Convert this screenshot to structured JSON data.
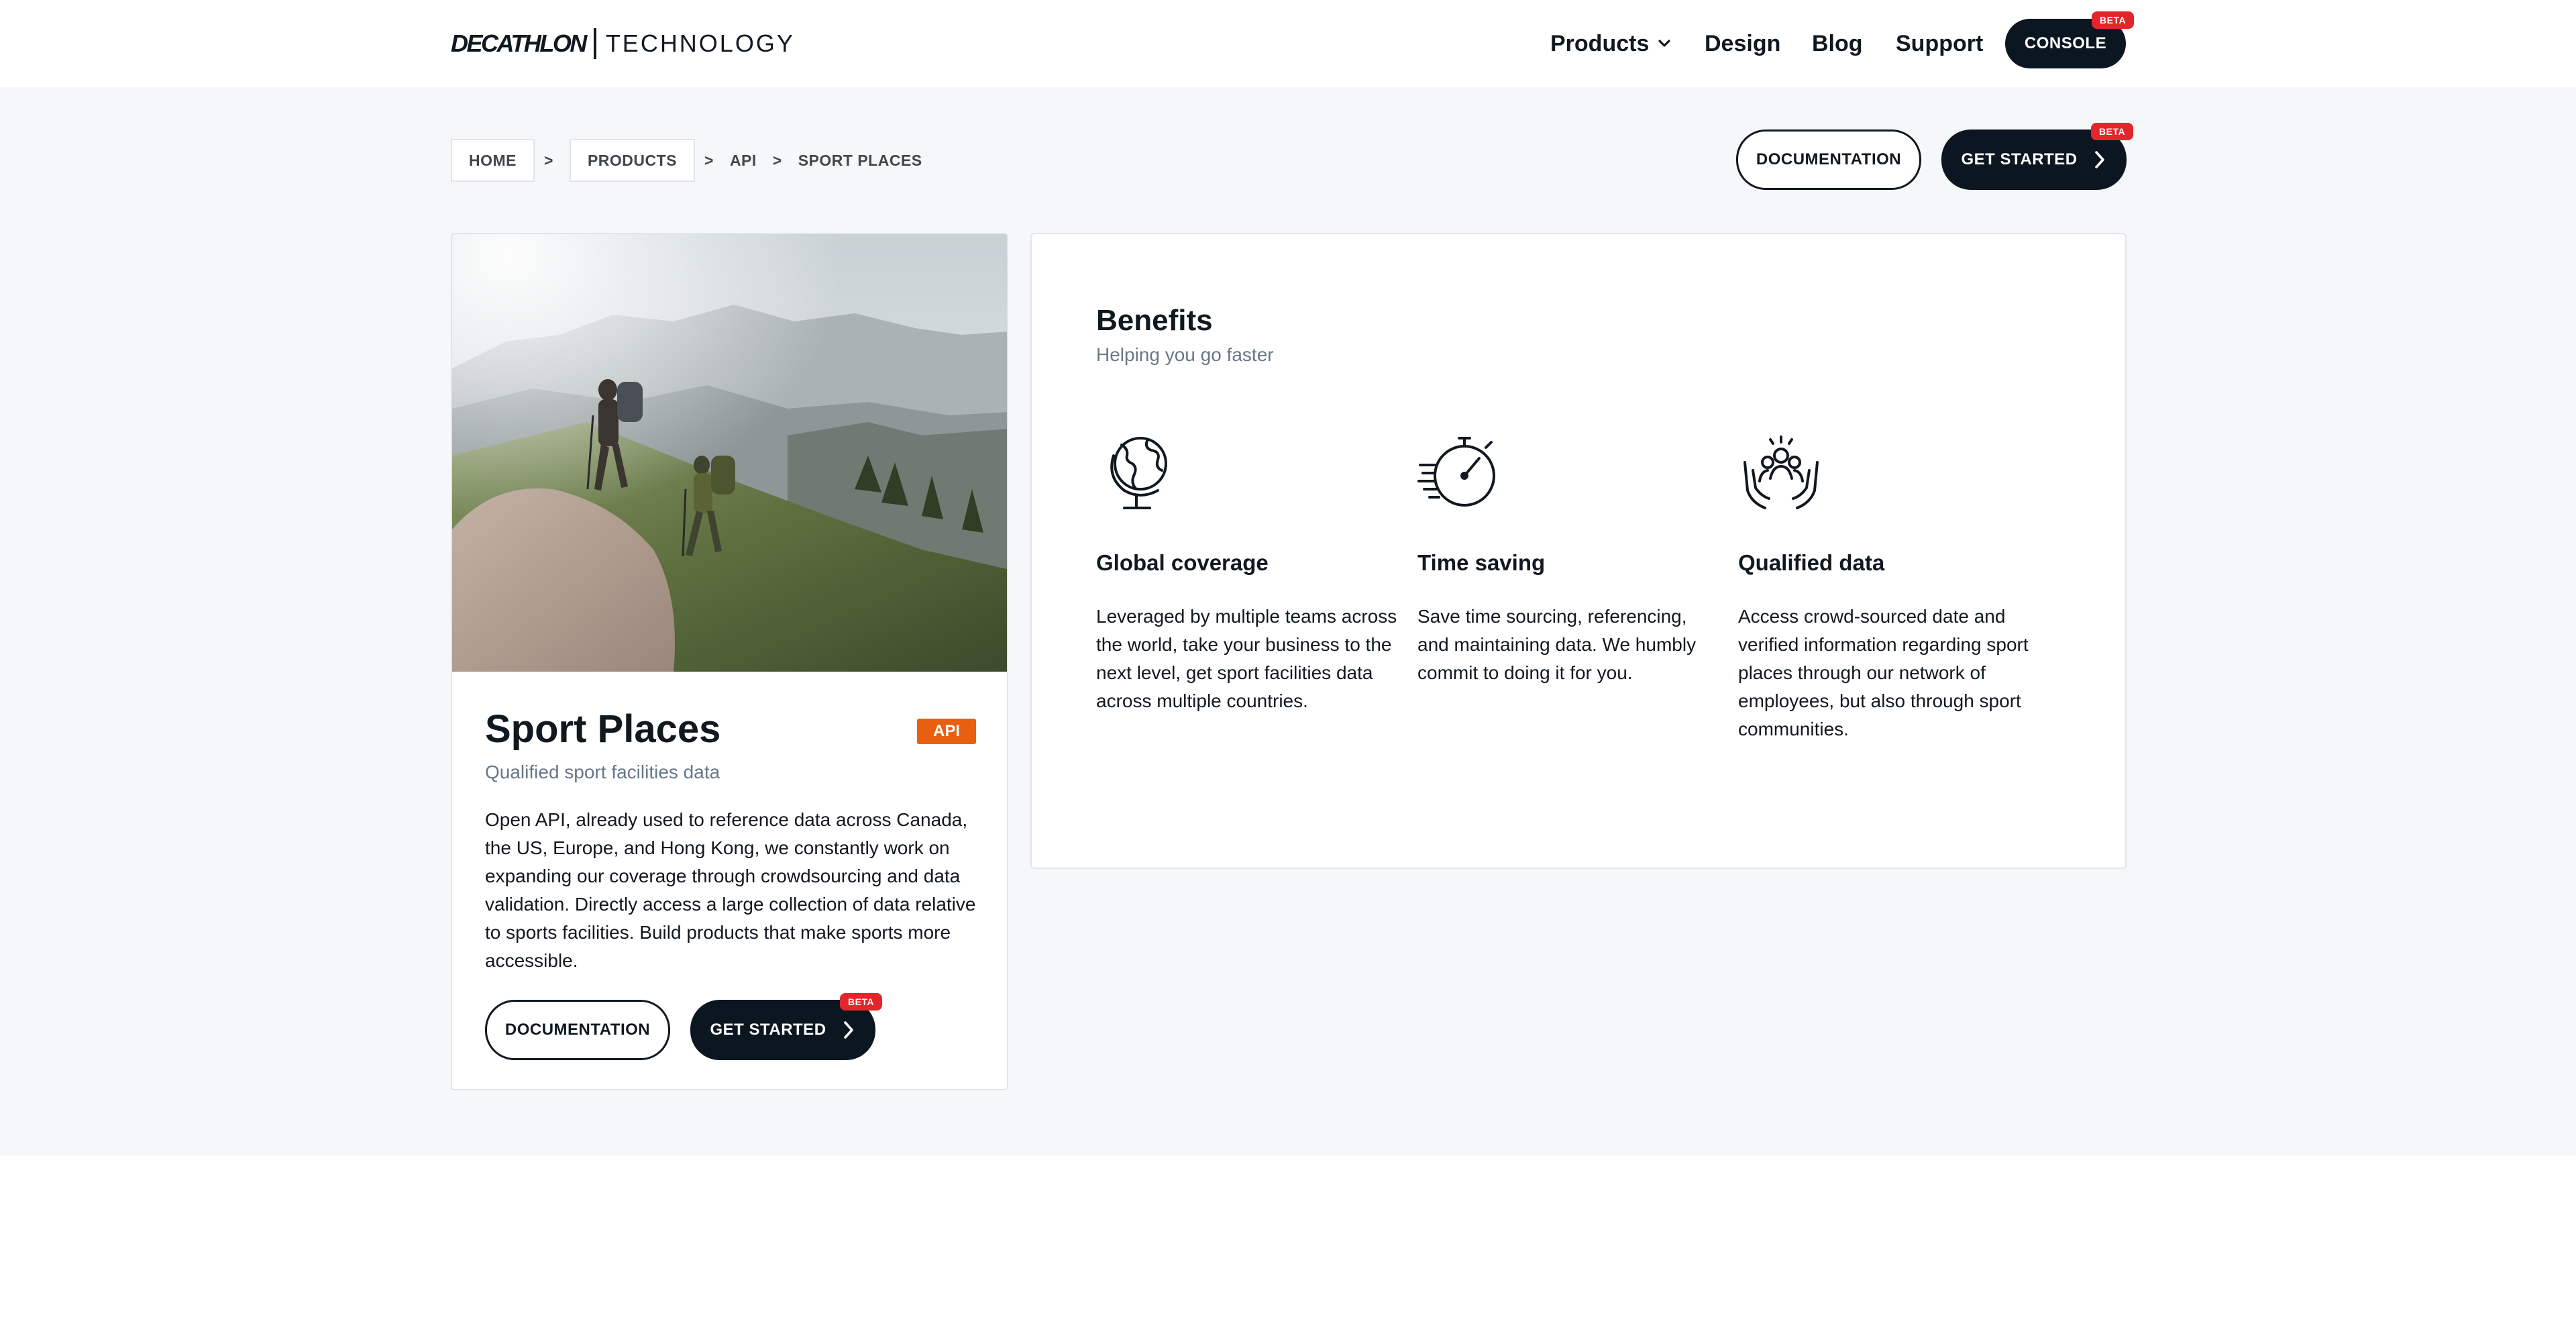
{
  "header": {
    "logo_brand": "DECATHLON",
    "logo_tech": "TECHNOLOGY",
    "nav": {
      "products": "Products",
      "design": "Design",
      "blog": "Blog",
      "support": "Support"
    },
    "console_label": "CONSOLE",
    "console_badge": "BETA"
  },
  "breadcrumb": {
    "home": "HOME",
    "products": "PRODUCTS",
    "api": "API",
    "current": "SPORT PLACES",
    "separator": ">"
  },
  "top_actions": {
    "documentation": "DOCUMENTATION",
    "get_started": "GET STARTED",
    "badge": "BETA"
  },
  "product": {
    "title": "Sport Places",
    "badge": "API",
    "subtitle": "Qualified sport facilities data",
    "description": "Open API, already used to reference data across Canada, the US, Europe, and Hong Kong, we constantly work on expanding our coverage through crowdsourcing and data validation. Directly access a large collection of data relative to sports facilities. Build products that make sports more accessible.",
    "documentation": "DOCUMENTATION",
    "get_started": "GET STARTED",
    "get_started_badge": "BETA"
  },
  "benefits": {
    "title": "Benefits",
    "subtitle": "Helping you go faster",
    "items": [
      {
        "icon": "globe-icon",
        "title": "Global coverage",
        "text": "Leveraged by multiple teams across the world, take your business to the next level, get sport facilities data across multiple countries."
      },
      {
        "icon": "stopwatch-icon",
        "title": "Time saving",
        "text": "Save time sourcing, referencing, and maintaining data. We humbly commit to doing it for you."
      },
      {
        "icon": "community-hands-icon",
        "title": "Qualified data",
        "text": "Access crowd-sourced date and verified information regarding sport places through our network of employees, but also through sport communities."
      }
    ]
  },
  "colors": {
    "primary_dark": "#0b1620",
    "beta_red": "#e3262b",
    "api_orange": "#e8600f",
    "band_bg": "#f5f7f9",
    "muted_text": "#687787"
  }
}
